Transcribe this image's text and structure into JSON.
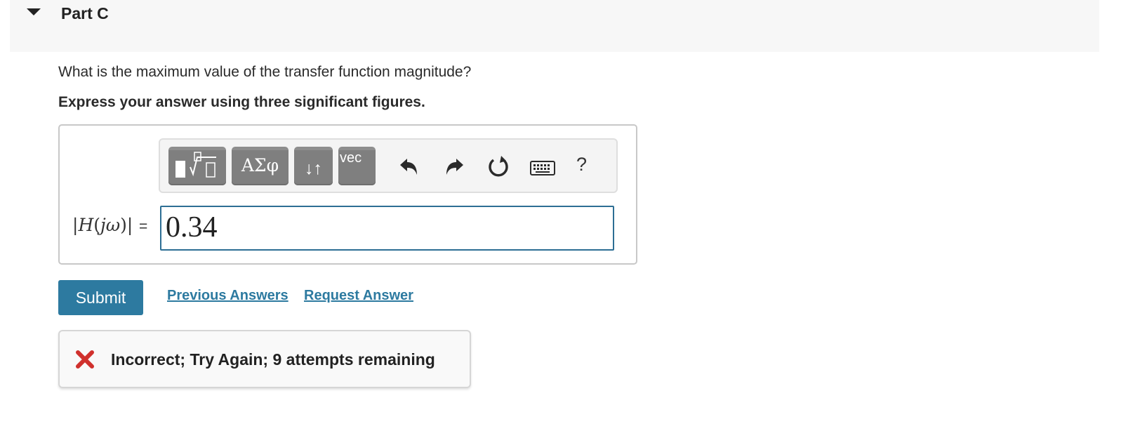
{
  "part": {
    "title": "Part C"
  },
  "question": {
    "prompt": "What is the maximum value of the transfer function magnitude?",
    "instruction": "Express your answer using three significant figures."
  },
  "toolbar": {
    "greek_label": "ΑΣφ",
    "arrows_label": "↓↑",
    "vec_label": "vec",
    "help_label": "?"
  },
  "answer": {
    "label_prefix": "|",
    "label_fn": "H",
    "label_paren_open": "(",
    "label_arg": "jω",
    "label_paren_close": ")|",
    "equals": "=",
    "value": "0.34"
  },
  "actions": {
    "submit_label": "Submit",
    "previous_answers_label": "Previous Answers",
    "request_answer_label": "Request Answer"
  },
  "feedback": {
    "message": "Incorrect; Try Again; 9 attempts remaining",
    "status_color": "#d0312d"
  },
  "colors": {
    "accent": "#2d7aa0",
    "input_border": "#2d6e94"
  }
}
